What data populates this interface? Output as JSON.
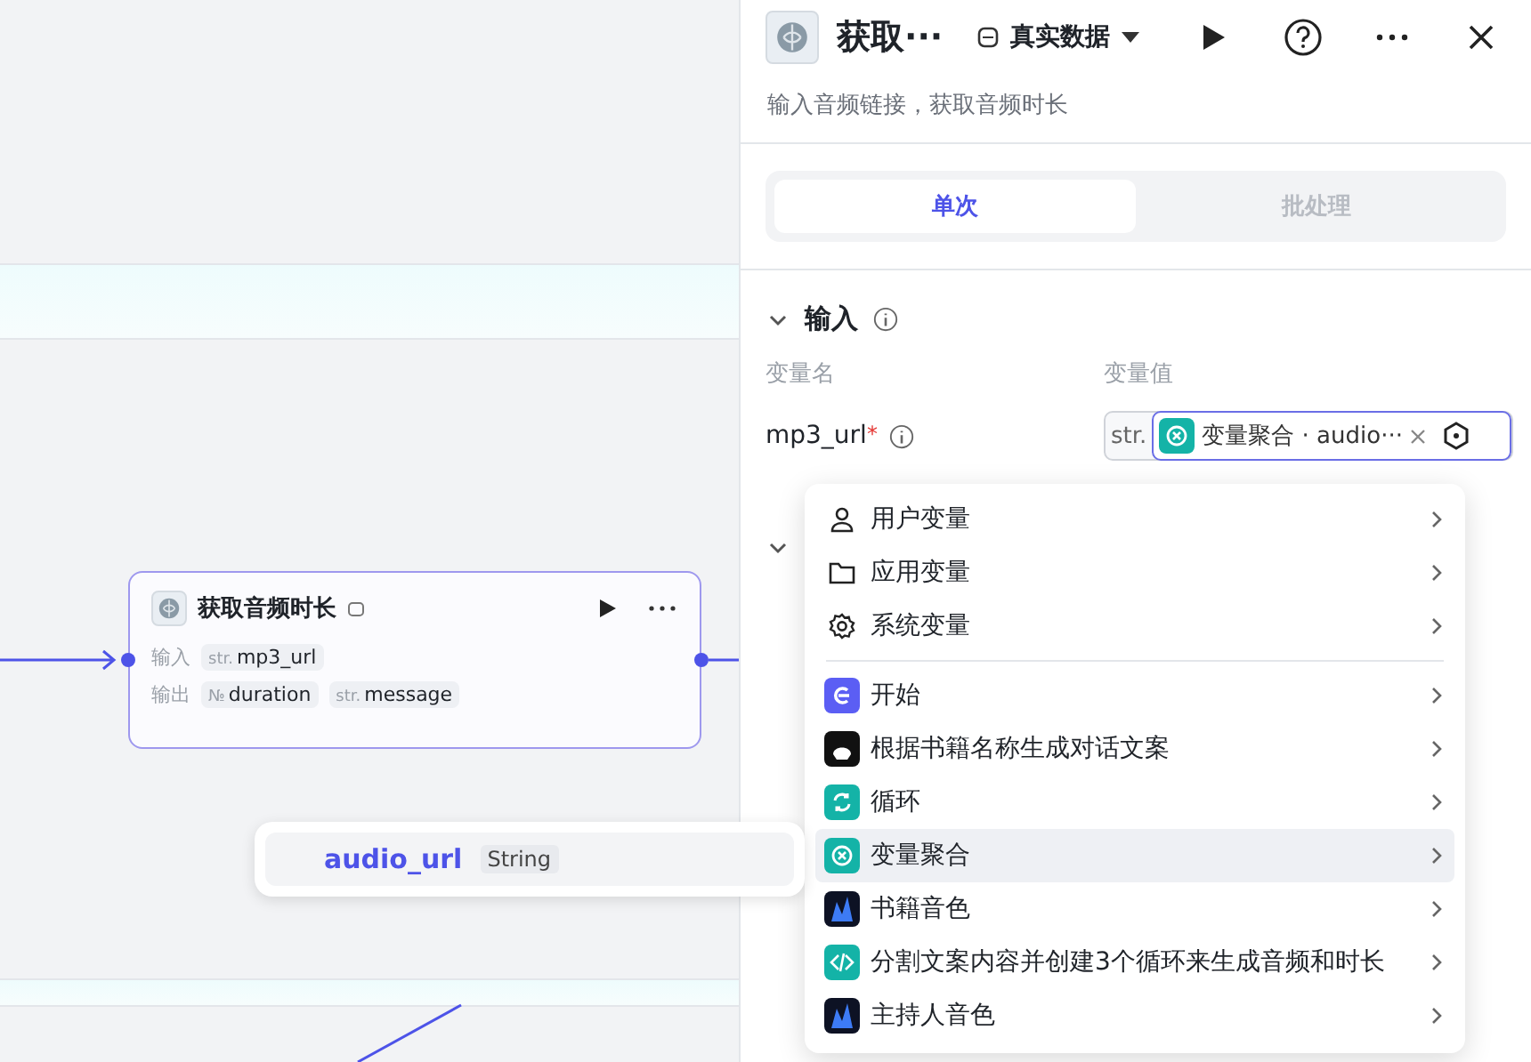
{
  "canvas": {
    "node": {
      "title": "获取音频时长",
      "inputs_label": "输入",
      "inputs": [
        {
          "type": "str.",
          "name": "mp3_url"
        }
      ],
      "outputs_label": "输出",
      "outputs": [
        {
          "type": "№",
          "name": "duration"
        },
        {
          "type": "str.",
          "name": "message"
        }
      ]
    },
    "drag_chip": {
      "name": "audio_url",
      "type": "String"
    }
  },
  "panel": {
    "title": "获取···",
    "data_mode": "真实数据",
    "description": "输入音频链接，获取音频时长",
    "tabs": [
      {
        "label": "单次",
        "selected": true
      },
      {
        "label": "批处理",
        "selected": false
      }
    ],
    "input_section": {
      "title": "输入",
      "expanded": true,
      "col_name": "变量名",
      "col_value": "变量值",
      "params": [
        {
          "name": "mp3_url",
          "required": true,
          "required_mark": "*",
          "type": "str.",
          "value": "变量聚合 · audio···"
        }
      ]
    },
    "output_section": {
      "expanded": true
    }
  },
  "menu": {
    "items": [
      {
        "kind": "person",
        "label": "用户变量",
        "highlighted": false
      },
      {
        "kind": "folder",
        "label": "应用变量",
        "highlighted": false
      },
      {
        "kind": "gear",
        "label": "系统变量",
        "highlighted": false
      },
      {
        "kind": "start",
        "label": "开始",
        "color": "#5b5ef4",
        "highlighted": false
      },
      {
        "kind": "chat",
        "label": "根据书籍名称生成对话文案",
        "color": "#111111",
        "highlighted": false
      },
      {
        "kind": "loop",
        "label": "循环",
        "color": "#14b3a7",
        "highlighted": false
      },
      {
        "kind": "aggregate",
        "label": "变量聚合",
        "color": "#14b3a7",
        "highlighted": true
      },
      {
        "kind": "voice",
        "label": "书籍音色",
        "color": "#0d1224",
        "highlighted": false
      },
      {
        "kind": "code",
        "label": "分割文案内容并创建3个循环来生成音频和时长",
        "color": "#14b3a7",
        "highlighted": false
      },
      {
        "kind": "voice",
        "label": "主持人音色",
        "color": "#0d1224",
        "highlighted": false
      }
    ]
  }
}
